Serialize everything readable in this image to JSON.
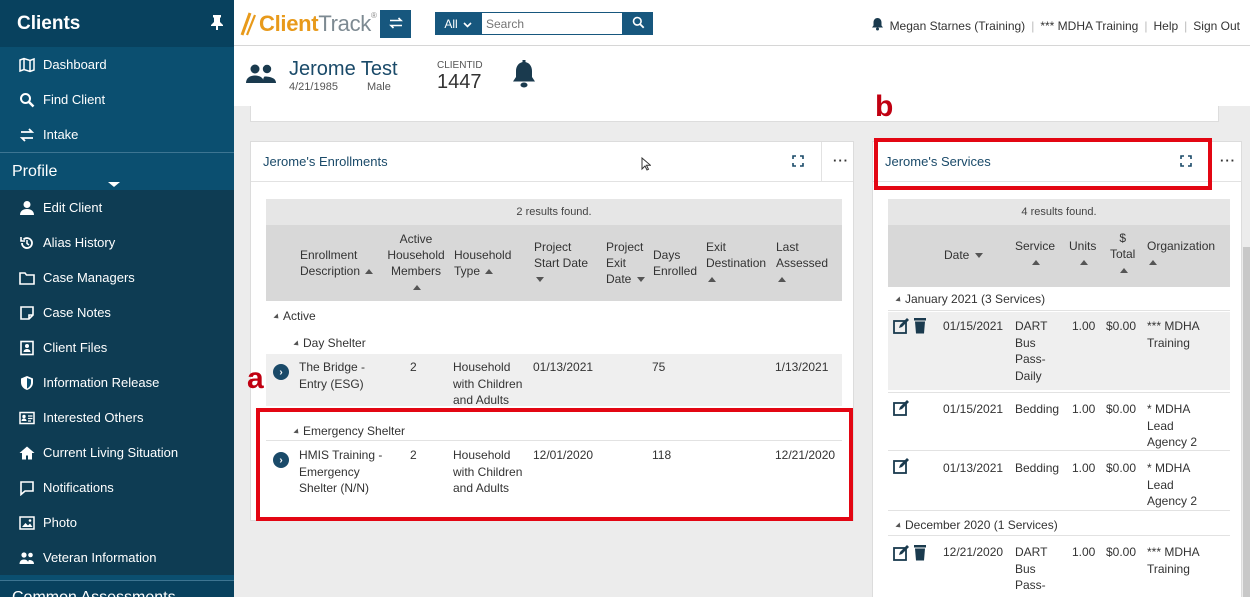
{
  "sidebar": {
    "title": "Clients",
    "top_items": [
      {
        "label": "Dashboard",
        "icon": "map-icon"
      },
      {
        "label": "Find Client",
        "icon": "search-icon"
      },
      {
        "label": "Intake",
        "icon": "swap-arrows-icon"
      }
    ],
    "profile_label": "Profile",
    "profile_items": [
      {
        "label": "Edit Client",
        "icon": "user-icon"
      },
      {
        "label": "Alias History",
        "icon": "history-icon"
      },
      {
        "label": "Case Managers",
        "icon": "folder-icon"
      },
      {
        "label": "Case Notes",
        "icon": "note-icon"
      },
      {
        "label": "Client Files",
        "icon": "file-icon"
      },
      {
        "label": "Information Release",
        "icon": "shield-icon"
      },
      {
        "label": "Interested Others",
        "icon": "id-card-icon"
      },
      {
        "label": "Current Living Situation",
        "icon": "home-icon"
      },
      {
        "label": "Notifications",
        "icon": "message-icon"
      },
      {
        "label": "Photo",
        "icon": "image-icon"
      },
      {
        "label": "Veteran Information",
        "icon": "users-icon"
      }
    ],
    "bottom_label": "Common Assessments"
  },
  "topbar": {
    "brand_client": "Client",
    "brand_track": "Track",
    "brand_reg": "®",
    "search_scope": "All",
    "search_placeholder": "Search",
    "user": "Megan Starnes (Training)",
    "org": "*** MDHA Training",
    "help": "Help",
    "signout": "Sign Out"
  },
  "client": {
    "name": "Jerome Test",
    "dob": "4/21/1985",
    "gender": "Male",
    "id_label": "CLIENTID",
    "id": "1447"
  },
  "enrollments": {
    "title": "Jerome's Enrollments",
    "results": "2 results found.",
    "headers": {
      "desc": "Enrollment Description",
      "members": "Active Household Members",
      "type": "Household Type",
      "start": "Project Start Date",
      "exit": "Project Exit Date",
      "days": "Days Enrolled",
      "dest": "Exit Destination",
      "assessed": "Last Assessed"
    },
    "group_active": "Active",
    "sub_day": "Day Shelter",
    "sub_emergency": "Emergency Shelter",
    "rows": [
      {
        "desc": "The Bridge - Entry (ESG)",
        "members": "2",
        "type": "Household with Children and Adults",
        "start": "01/13/2021",
        "days": "75",
        "assessed": "1/13/2021"
      },
      {
        "desc": "HMIS Training - Emergency Shelter (N/N)",
        "members": "2",
        "type": "Household with Children and Adults",
        "start": "12/01/2020",
        "days": "118",
        "assessed": "12/21/2020"
      }
    ]
  },
  "services": {
    "title": "Jerome's Services",
    "results": "4 results found.",
    "headers": {
      "date": "Date",
      "service": "Service",
      "units": "Units",
      "total_sym": "$",
      "total": "Total",
      "org": "Organization"
    },
    "group_jan": "January 2021 (3 Services)",
    "group_dec": "December 2020 (1 Services)",
    "rows": [
      {
        "date": "01/15/2021",
        "service": "DART Bus Pass- Daily",
        "units": "1.00",
        "total": "$0.00",
        "org": "*** MDHA Training"
      },
      {
        "date": "01/15/2021",
        "service": "Bedding",
        "units": "1.00",
        "total": "$0.00",
        "org": "* MDHA Lead Agency 2"
      },
      {
        "date": "01/13/2021",
        "service": "Bedding",
        "units": "1.00",
        "total": "$0.00",
        "org": "* MDHA Lead Agency 2"
      },
      {
        "date": "12/21/2020",
        "service": "DART Bus Pass- Daily",
        "units": "1.00",
        "total": "$0.00",
        "org": "*** MDHA Training"
      }
    ]
  },
  "annotations": {
    "a": "a",
    "b": "b",
    "color": "#e30613"
  }
}
